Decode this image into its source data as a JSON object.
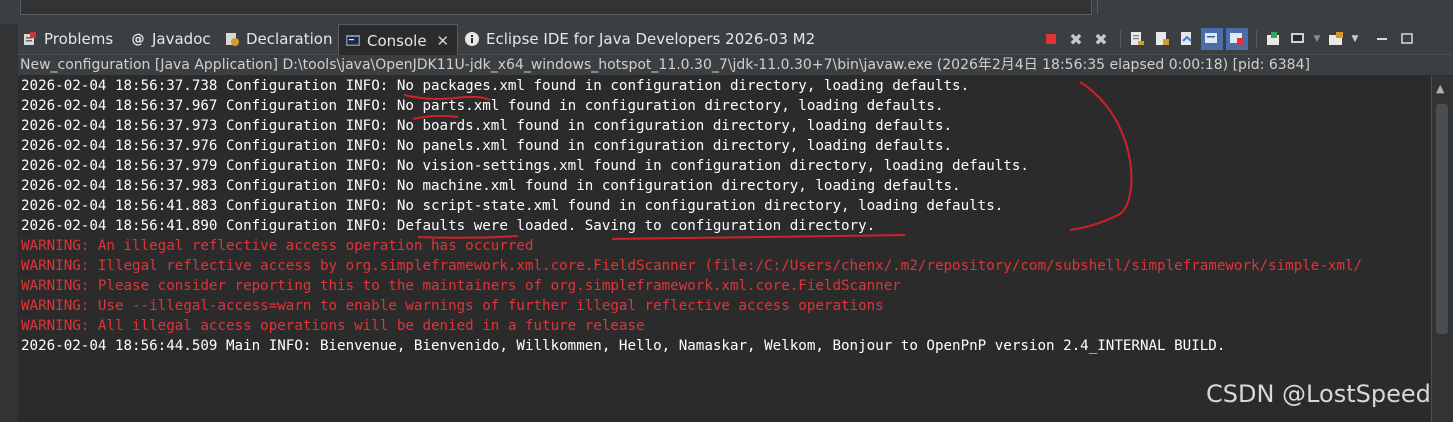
{
  "tabs": [
    {
      "label": "Problems",
      "icon": "problems-icon"
    },
    {
      "label": "Javadoc",
      "icon": "javadoc-icon"
    },
    {
      "label": "Declaration",
      "icon": "declaration-icon"
    },
    {
      "label": "Console",
      "icon": "console-icon",
      "active": true
    },
    {
      "label": "Eclipse IDE for Java Developers 2026-03 M2",
      "icon": "info-icon"
    }
  ],
  "close_glyph": "✕",
  "toolbar_icons": [
    "terminate-icon",
    "remove-launch-icon",
    "remove-all-terminated-icon",
    "clear-console-icon",
    "scroll-lock-icon",
    "word-wrap-icon",
    "show-on-output-icon",
    "show-on-error-icon",
    "pin-console-icon",
    "display-selected-console-icon",
    "open-console-icon",
    "view-menu-icon",
    "minimize-icon",
    "maximize-icon"
  ],
  "process_info": "New_configuration [Java Application] D:\\tools\\java\\OpenJDK11U-jdk_x64_windows_hotspot_11.0.30_7\\jdk-11.0.30+7\\bin\\javaw.exe  (2026年2月4日 18:56:35 elapsed 0:00:18) [pid: 6384]",
  "console_lines": [
    {
      "type": "info",
      "text": "2026-02-04 18:56:37.738 Configuration INFO: No packages.xml found in configuration directory, loading defaults."
    },
    {
      "type": "info",
      "text": "2026-02-04 18:56:37.967 Configuration INFO: No parts.xml found in configuration directory, loading defaults."
    },
    {
      "type": "info",
      "text": "2026-02-04 18:56:37.973 Configuration INFO: No boards.xml found in configuration directory, loading defaults."
    },
    {
      "type": "info",
      "text": "2026-02-04 18:56:37.976 Configuration INFO: No panels.xml found in configuration directory, loading defaults."
    },
    {
      "type": "info",
      "text": "2026-02-04 18:56:37.979 Configuration INFO: No vision-settings.xml found in configuration directory, loading defaults."
    },
    {
      "type": "info",
      "text": "2026-02-04 18:56:37.983 Configuration INFO: No machine.xml found in configuration directory, loading defaults."
    },
    {
      "type": "info",
      "text": "2026-02-04 18:56:41.883 Configuration INFO: No script-state.xml found in configuration directory, loading defaults."
    },
    {
      "type": "info",
      "text": "2026-02-04 18:56:41.890 Configuration INFO: Defaults were loaded. Saving to configuration directory."
    },
    {
      "type": "warn",
      "text": "WARNING: An illegal reflective access operation has occurred"
    },
    {
      "type": "warn",
      "text": "WARNING: Illegal reflective access by org.simpleframework.xml.core.FieldScanner (file:/C:/Users/chenx/.m2/repository/com/subshell/simpleframework/simple-xml/"
    },
    {
      "type": "warn",
      "text": "WARNING: Please consider reporting this to the maintainers of org.simpleframework.xml.core.FieldScanner"
    },
    {
      "type": "warn",
      "text": "WARNING: Use --illegal-access=warn to enable warnings of further illegal reflective access operations"
    },
    {
      "type": "warn",
      "text": "WARNING: All illegal access operations will be denied in a future release"
    },
    {
      "type": "info",
      "text": "2026-02-04 18:56:44.509 Main INFO: Bienvenue, Bienvenido, Willkommen, Hello, Namaskar, Welkom, Bonjour to OpenPnP version 2.4_INTERNAL BUILD."
    }
  ],
  "watermark": "CSDN @LostSpeed",
  "colors": {
    "info_text": "#ffffff",
    "warning_text": "#e0343a",
    "annotation": "#d0202a"
  }
}
